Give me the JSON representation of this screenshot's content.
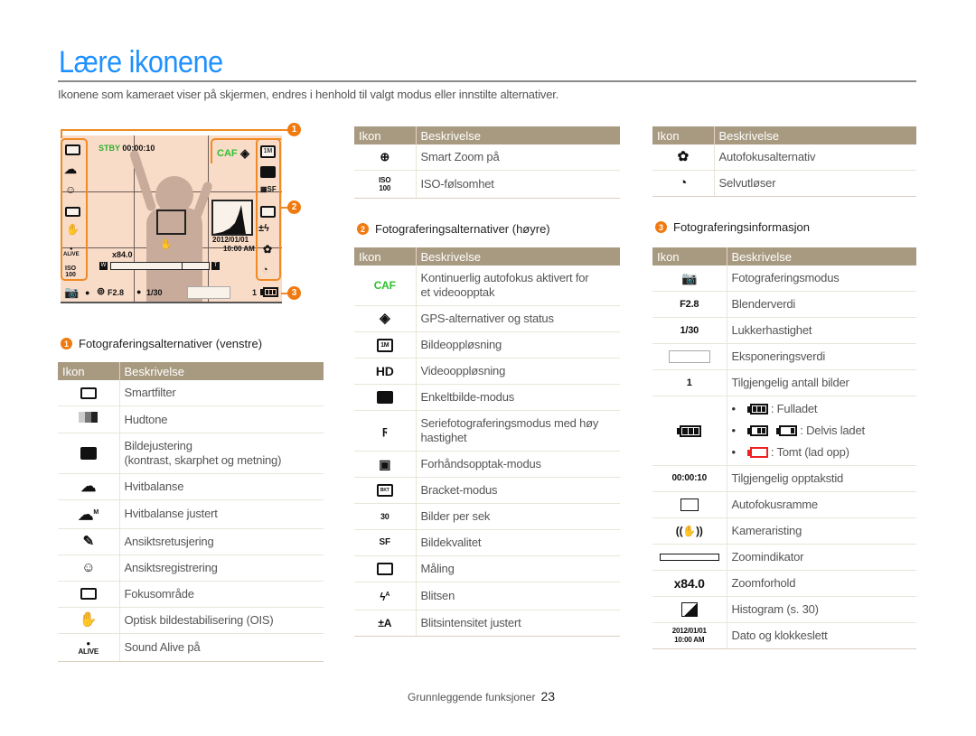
{
  "title": "Lære ikonene",
  "intro": "Ikonene som kameraet viser på skjermen, endres i henhold til valgt modus eller innstilte alternativer.",
  "colors": {
    "title": "#1e90ff",
    "callout": "#f07a10",
    "table_header": "#a89a80",
    "green": "#2fc02f",
    "battery_empty": "#e22222"
  },
  "screen": {
    "stby_label": "STBY",
    "stby_time": "00:00:10",
    "caf": "CAF",
    "zoom_ratio": "x84.0",
    "date": "2012/01/01",
    "time": "10:00 AM",
    "aperture": "F2.8",
    "shutter": "1/30",
    "shots": "1",
    "zoom_w": "W",
    "zoom_t": "T",
    "callouts": [
      "1",
      "2",
      "3"
    ]
  },
  "table_headers": {
    "icon": "Ikon",
    "desc": "Beskrivelse"
  },
  "section1": {
    "num": "1",
    "title": "Fotograferingsalternativer (venstre)",
    "rows": [
      {
        "icon": "smart-filter-icon",
        "desc": "Smartfilter"
      },
      {
        "icon": "skin-tone-icon",
        "desc": "Hudtone"
      },
      {
        "icon": "image-adjust-icon",
        "desc": "Bildejustering",
        "desc2": "(kontrast, skarphet og metning)"
      },
      {
        "icon": "white-balance-icon",
        "desc": "Hvitbalanse"
      },
      {
        "icon": "white-balance-adjusted-icon",
        "desc": "Hvitbalanse justert"
      },
      {
        "icon": "face-retouch-icon",
        "desc": "Ansiktsretusjering"
      },
      {
        "icon": "face-detection-icon",
        "desc": "Ansiktsregistrering"
      },
      {
        "icon": "focus-area-icon",
        "desc": "Fokusområde"
      },
      {
        "icon": "ois-icon",
        "desc": "Optisk bildestabilisering (OIS)"
      },
      {
        "icon": "sound-alive-icon",
        "desc": "Sound Alive på"
      }
    ]
  },
  "section1_cont": {
    "rows": [
      {
        "icon": "smart-zoom-icon",
        "desc": "Smart Zoom på"
      },
      {
        "icon": "iso-icon",
        "desc": "ISO-følsomhet"
      }
    ]
  },
  "section2": {
    "num": "2",
    "title": "Fotograferingsalternativer (høyre)",
    "rows": [
      {
        "icon": "caf-icon",
        "icon_text": "CAF",
        "desc": "Kontinuerlig autofokus aktivert for",
        "desc2": "et videoopptak"
      },
      {
        "icon": "gps-icon",
        "desc": "GPS-alternativer og status"
      },
      {
        "icon": "resolution-icon",
        "icon_text": "1M",
        "desc": "Bildeoppløsning"
      },
      {
        "icon": "hd-icon",
        "icon_text": "HD",
        "desc": "Videooppløsning"
      },
      {
        "icon": "single-shot-icon",
        "desc": "Enkeltbilde-modus"
      },
      {
        "icon": "burst-icon",
        "desc": "Seriefotograferingsmodus med høy",
        "desc2": "hastighet"
      },
      {
        "icon": "pre-capture-icon",
        "desc": "Forhåndsopptak-modus"
      },
      {
        "icon": "bracket-icon",
        "icon_text": "BKT",
        "desc": "Bracket-modus"
      },
      {
        "icon": "fps-icon",
        "icon_text": "30",
        "desc": "Bilder per sek"
      },
      {
        "icon": "quality-icon",
        "icon_text": "SF",
        "desc": "Bildekvalitet"
      },
      {
        "icon": "metering-icon",
        "desc": "Måling"
      },
      {
        "icon": "flash-icon",
        "icon_text": "A",
        "desc": "Blitsen"
      },
      {
        "icon": "flash-intensity-icon",
        "icon_text": "±A",
        "desc": "Blitsintensitet justert"
      }
    ]
  },
  "section2_cont": {
    "rows": [
      {
        "icon": "macro-icon",
        "desc": "Autofokusalternativ"
      },
      {
        "icon": "self-timer-icon",
        "desc": "Selvutløser"
      }
    ]
  },
  "section3": {
    "num": "3",
    "title": "Fotograferingsinformasjon",
    "rows": [
      {
        "icon": "shooting-mode-icon",
        "desc": "Fotograferingsmodus"
      },
      {
        "icon": "aperture-icon",
        "icon_text": "F2.8",
        "desc": "Blenderverdi"
      },
      {
        "icon": "shutter-icon",
        "icon_text": "1/30",
        "desc": "Lukkerhastighet"
      },
      {
        "icon": "exposure-icon",
        "desc": "Eksponeringsverdi"
      },
      {
        "icon": "shots-icon",
        "icon_text": "1",
        "desc": "Tilgjengelig antall bilder"
      },
      {
        "icon": "battery-icon",
        "battery": [
          {
            "desc": ": Fulladet"
          },
          {
            "desc": ": Delvis ladet"
          },
          {
            "desc": ": Tomt (lad opp)"
          }
        ]
      },
      {
        "icon": "record-time-icon",
        "icon_text": "00:00:10",
        "desc": "Tilgjengelig opptakstid"
      },
      {
        "icon": "af-frame-icon",
        "desc": "Autofokusramme"
      },
      {
        "icon": "camera-shake-icon",
        "desc": "Kameraristing"
      },
      {
        "icon": "zoom-indicator-icon",
        "desc": "Zoomindikator"
      },
      {
        "icon": "zoom-ratio-icon",
        "icon_text": "x84.0",
        "desc": "Zoomforhold"
      },
      {
        "icon": "histogram-icon",
        "desc": "Histogram (s. 30)"
      },
      {
        "icon": "date-time-icon",
        "icon_text": "2012/01/01",
        "icon_text2": "10:00 AM",
        "desc": "Dato og klokkeslett"
      }
    ]
  },
  "footer": {
    "section": "Grunnleggende funksjoner",
    "page": "23"
  }
}
